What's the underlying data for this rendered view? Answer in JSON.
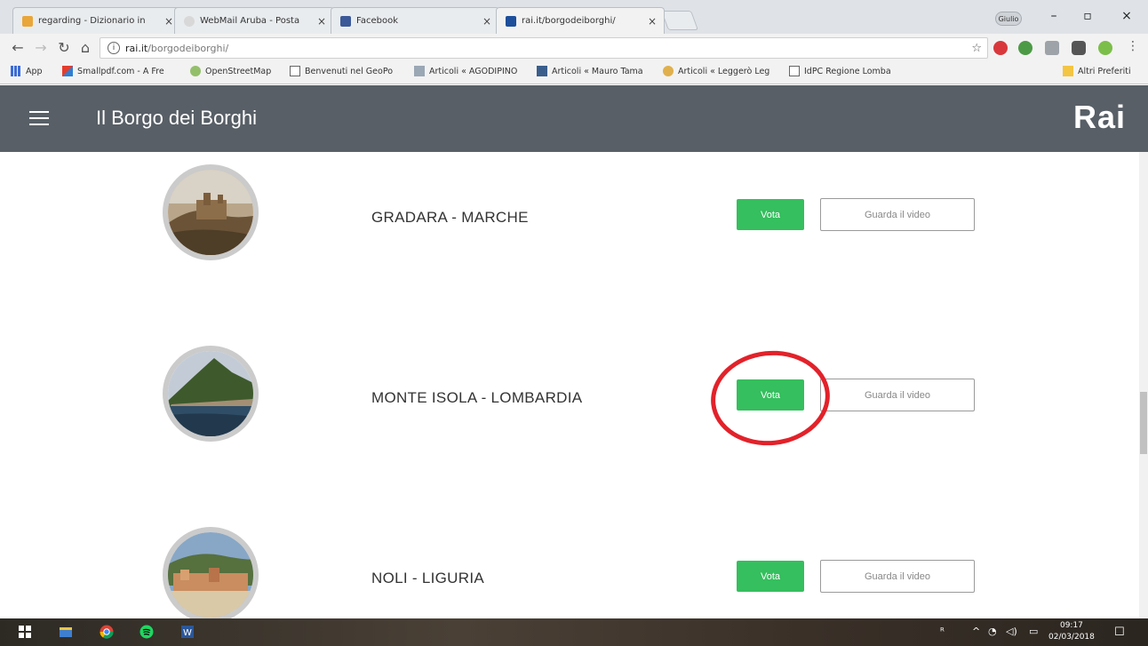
{
  "browser": {
    "tabs": [
      {
        "title": "regarding - Dizionario in",
        "favicon_color": "#e9a63a"
      },
      {
        "title": "WebMail Aruba - Posta",
        "favicon_color": "#d8d8d8"
      },
      {
        "title": "Facebook",
        "favicon_color": "#3b5998"
      },
      {
        "title": "rai.it/borgodeiborghi/",
        "favicon_color": "#1d4f9c"
      }
    ],
    "profile_label": "Giulio",
    "url": {
      "host": "rai.it",
      "path": "/borgodeiborghi/"
    },
    "bookmarks": [
      {
        "label": "App",
        "icon": "apps-grid-icon"
      },
      {
        "label": "Smallpdf.com - A Fre",
        "icon": "smallpdf-icon"
      },
      {
        "label": "OpenStreetMap",
        "icon": "osm-icon"
      },
      {
        "label": "Benvenuti nel GeoPo",
        "icon": "page-icon"
      },
      {
        "label": "Articoli « AGODIPINO",
        "icon": "article-icon"
      },
      {
        "label": "Articoli « Mauro Tama",
        "icon": "article-icon"
      },
      {
        "label": "Articoli « Leggerò Leg",
        "icon": "article-icon"
      },
      {
        "label": "IdPC Regione Lomba",
        "icon": "page-icon"
      }
    ],
    "other_bookmarks": "Altri Preferiti"
  },
  "site": {
    "title": "Il Borgo dei Borghi",
    "logo": "Rai"
  },
  "villages": [
    {
      "name": "GRADARA - MARCHE",
      "vote_label": "Vota",
      "video_label": "Guarda il video"
    },
    {
      "name": "MONTE ISOLA - LOMBARDIA",
      "vote_label": "Vota",
      "video_label": "Guarda il video"
    },
    {
      "name": "NOLI - LIGURIA",
      "vote_label": "Vota",
      "video_label": "Guarda il video"
    }
  ],
  "taskbar": {
    "time": "09:17",
    "date": "02/03/2018"
  },
  "colors": {
    "header_bg": "#585f66",
    "vote_green": "#35bf5e",
    "annotation_red": "#e2222a"
  }
}
